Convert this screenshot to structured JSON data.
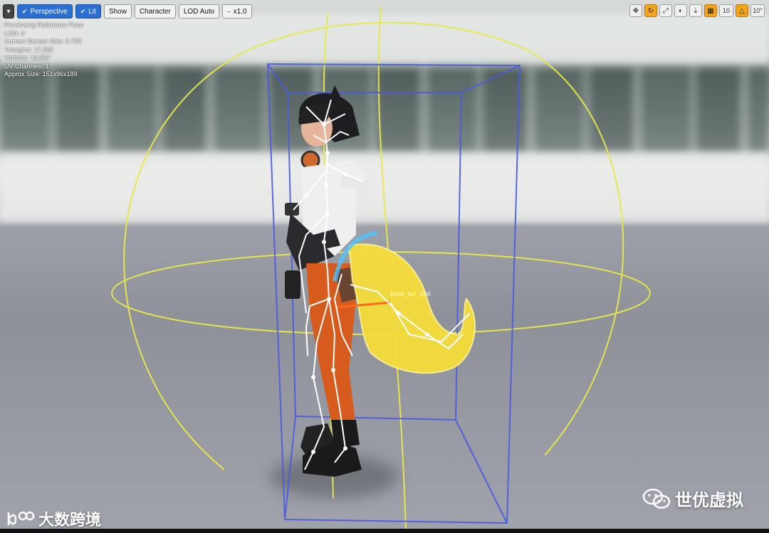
{
  "toolbar": {
    "menu_label": "▾",
    "perspective_label": "Perspective",
    "lit_label": "Lit",
    "show_label": "Show",
    "character_label": "Character",
    "lod_label": "LOD Auto",
    "speed_label": "x1.0"
  },
  "right_toolbar": {
    "icons": [
      "translate-icon",
      "rotate-icon",
      "scale-icon",
      "world-local-icon",
      "surface-snap-icon",
      "grid-snap-icon",
      "rotation-snap-icon"
    ],
    "grid_snap_value": "10",
    "rotation_snap_value": "10°"
  },
  "stats": {
    "line1": "Previewing Reference Pose",
    "line2": "LOD: 0",
    "line3": "Current Screen Size: 0.752",
    "line4": "Triangles: 17,882",
    "line5": "Vertices: 13,957",
    "line6": "UV Channels: 1",
    "line7": "Approx Size: 151x96x189"
  },
  "bone_label": "bone_tail_004",
  "watermark_right": "世优虚拟",
  "watermark_left": "大数跨境",
  "colors": {
    "bounds_sphere": "#e9e84a",
    "bounds_box": "#4a5be0",
    "accent_orange": "#f2a51c"
  }
}
